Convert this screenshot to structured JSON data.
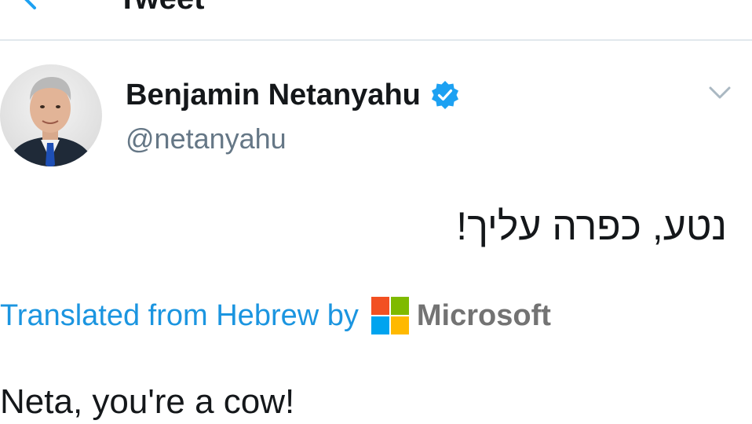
{
  "header": {
    "title": "Tweet",
    "back_icon": "back-arrow-icon"
  },
  "tweet": {
    "author": {
      "display_name": "Benjamin Netanyahu",
      "handle": "@netanyahu",
      "verified": true,
      "verified_icon": "verified-badge-icon"
    },
    "menu_icon": "chevron-down-icon",
    "original_text": "נטע, כפרה עליך!",
    "translation": {
      "label": "Translated from Hebrew by",
      "provider": "Microsoft",
      "provider_logo": "microsoft-logo-icon"
    },
    "translated_text": "Neta, you're a cow!"
  },
  "colors": {
    "accent": "#1da1f2",
    "link": "#1b95e0",
    "muted": "#657786",
    "divider": "#e1e8ed",
    "text": "#14171a",
    "ms_red": "#f25022",
    "ms_green": "#7fba00",
    "ms_blue": "#00a4ef",
    "ms_yellow": "#ffb900"
  }
}
